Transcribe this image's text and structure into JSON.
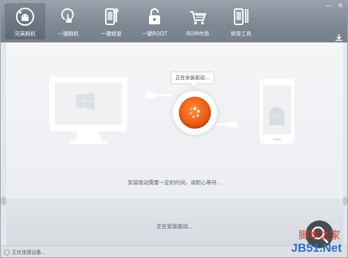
{
  "window": {
    "controls": {
      "minimize": "—",
      "close": "✕"
    }
  },
  "nav": {
    "items": [
      {
        "label": "完美刷机",
        "icon": "android-refresh-icon",
        "active": true
      },
      {
        "label": "一键刷机",
        "icon": "touch-hand-icon",
        "active": false
      },
      {
        "label": "一键修复",
        "icon": "phone-wrench-icon",
        "active": false
      },
      {
        "label": "一键ROOT",
        "icon": "unlock-icon",
        "active": false
      },
      {
        "label": "ROM市场",
        "icon": "shopping-cart-icon",
        "active": false
      },
      {
        "label": "常用工具",
        "icon": "phone-tools-icon",
        "active": false
      }
    ]
  },
  "main": {
    "tooltip": "正在安装驱动...",
    "info": "安装驱动需要一定的时间，请耐心等待..."
  },
  "bottom": {
    "status": "正在安装驱动..."
  },
  "statusbar": {
    "text": "正在连接设备..."
  },
  "watermark": {
    "top": "脚本之家",
    "bottom": "JB51.Net"
  },
  "colors": {
    "toolbar": "#8a939d",
    "accent_orange": "#e85a12",
    "watermark_red": "#d23a2a",
    "watermark_blue": "#2a70c6"
  }
}
